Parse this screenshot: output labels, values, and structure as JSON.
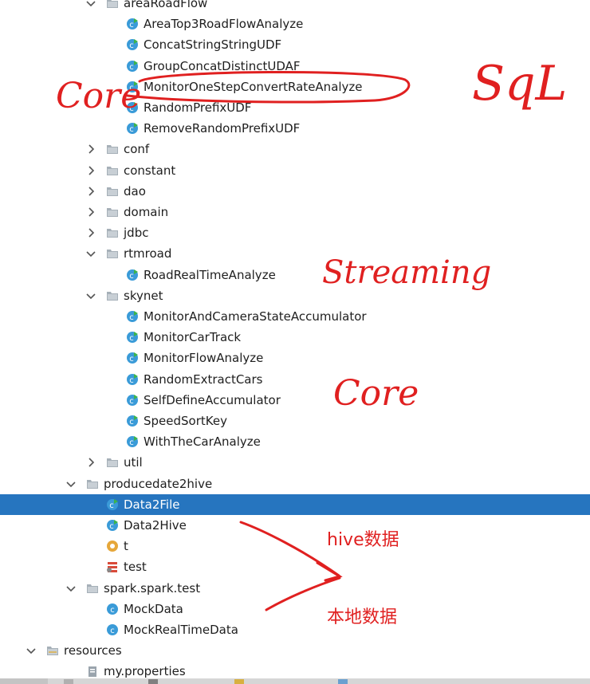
{
  "tree": {
    "rows": [
      {
        "label": "areaRoadFlow",
        "kind": "folder",
        "expand": "open",
        "indent": 1
      },
      {
        "label": "AreaTop3RoadFlowAnalyze",
        "kind": "class-run",
        "indent": 2
      },
      {
        "label": "ConcatStringStringUDF",
        "kind": "class-run",
        "indent": 2
      },
      {
        "label": "GroupConcatDistinctUDAF",
        "kind": "class-run",
        "indent": 2
      },
      {
        "label": "MonitorOneStepConvertRateAnalyze",
        "kind": "class-run",
        "indent": 2
      },
      {
        "label": "RandomPrefixUDF",
        "kind": "class-run",
        "indent": 2
      },
      {
        "label": "RemoveRandomPrefixUDF",
        "kind": "class-run",
        "indent": 2
      },
      {
        "label": "conf",
        "kind": "folder",
        "expand": "closed",
        "indent": 1
      },
      {
        "label": "constant",
        "kind": "folder",
        "expand": "closed",
        "indent": 1
      },
      {
        "label": "dao",
        "kind": "folder",
        "expand": "closed",
        "indent": 1
      },
      {
        "label": "domain",
        "kind": "folder",
        "expand": "closed",
        "indent": 1
      },
      {
        "label": "jdbc",
        "kind": "folder",
        "expand": "closed",
        "indent": 1
      },
      {
        "label": "rtmroad",
        "kind": "folder",
        "expand": "open",
        "indent": 1
      },
      {
        "label": "RoadRealTimeAnalyze",
        "kind": "class-run",
        "indent": 2
      },
      {
        "label": "skynet",
        "kind": "folder",
        "expand": "open",
        "indent": 1
      },
      {
        "label": "MonitorAndCameraStateAccumulator",
        "kind": "class-run",
        "indent": 2
      },
      {
        "label": "MonitorCarTrack",
        "kind": "class-run",
        "indent": 2
      },
      {
        "label": "MonitorFlowAnalyze",
        "kind": "class-run",
        "indent": 2
      },
      {
        "label": "RandomExtractCars",
        "kind": "class-run",
        "indent": 2
      },
      {
        "label": "SelfDefineAccumulator",
        "kind": "class-run",
        "indent": 2
      },
      {
        "label": "SpeedSortKey",
        "kind": "class-run",
        "indent": 2
      },
      {
        "label": "WithTheCarAnalyze",
        "kind": "class-run",
        "indent": 2
      },
      {
        "label": "util",
        "kind": "folder",
        "expand": "closed",
        "indent": 1
      },
      {
        "label": "producedate2hive",
        "kind": "folder",
        "expand": "open",
        "indent": 0
      },
      {
        "label": "Data2File",
        "kind": "class-run",
        "indent": 1,
        "selected": true
      },
      {
        "label": "Data2Hive",
        "kind": "class-run",
        "indent": 1
      },
      {
        "label": "t",
        "kind": "object",
        "indent": 1
      },
      {
        "label": "test",
        "kind": "scala",
        "indent": 1
      },
      {
        "label": "spark.spark.test",
        "kind": "folder",
        "expand": "open",
        "indent": 0
      },
      {
        "label": "MockData",
        "kind": "class",
        "indent": 1
      },
      {
        "label": "MockRealTimeData",
        "kind": "class",
        "indent": 1
      },
      {
        "label": "resources",
        "kind": "res-folder",
        "expand": "open",
        "indent": -1
      },
      {
        "label": "my.properties",
        "kind": "props",
        "indent": 0
      }
    ]
  },
  "annotations": {
    "core_top": "Core",
    "sql": "SqL",
    "streaming": "Streaming",
    "core_mid": "Core",
    "hive": "hive数据",
    "local": "本地数据"
  },
  "colors": {
    "selection": "#2675bf",
    "class_icon": "#3a9bd8",
    "run_badge": "#3cb44b",
    "folder": "#9aa4ad",
    "annotation": "#e02020"
  }
}
